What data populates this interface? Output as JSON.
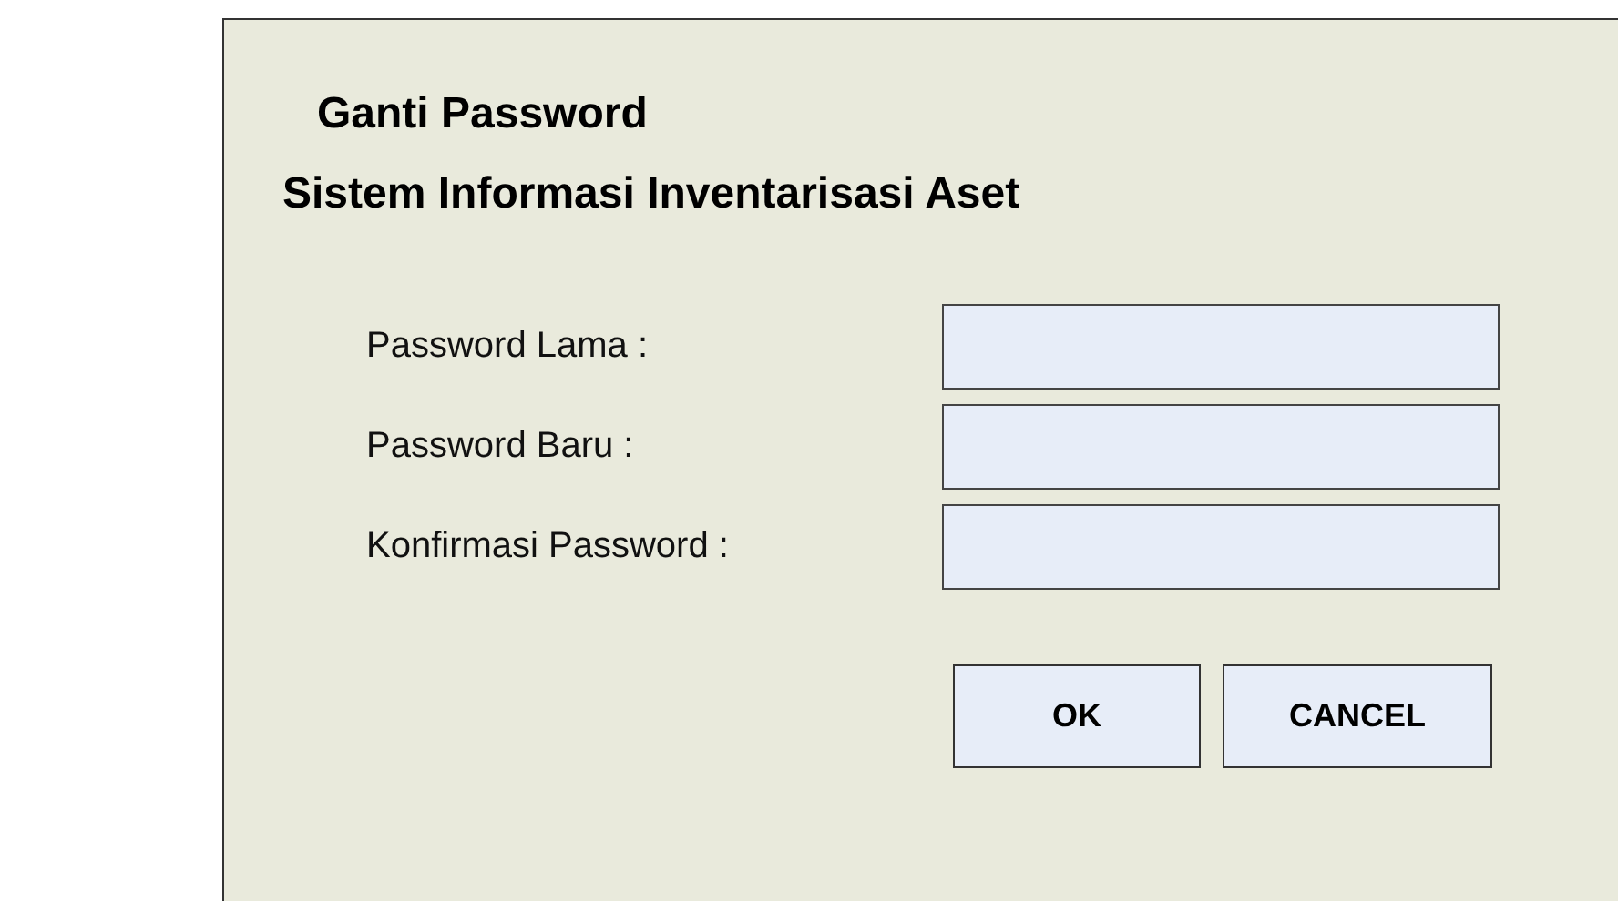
{
  "title": "Ganti Password",
  "subtitle": "Sistem Informasi Inventarisasi Aset",
  "fields": [
    {
      "label": "Password Lama :"
    },
    {
      "label": "Password Baru :"
    },
    {
      "label": "Konfirmasi Password :"
    }
  ],
  "buttons": [
    {
      "label": "OK"
    },
    {
      "label": "CANCEL"
    }
  ]
}
